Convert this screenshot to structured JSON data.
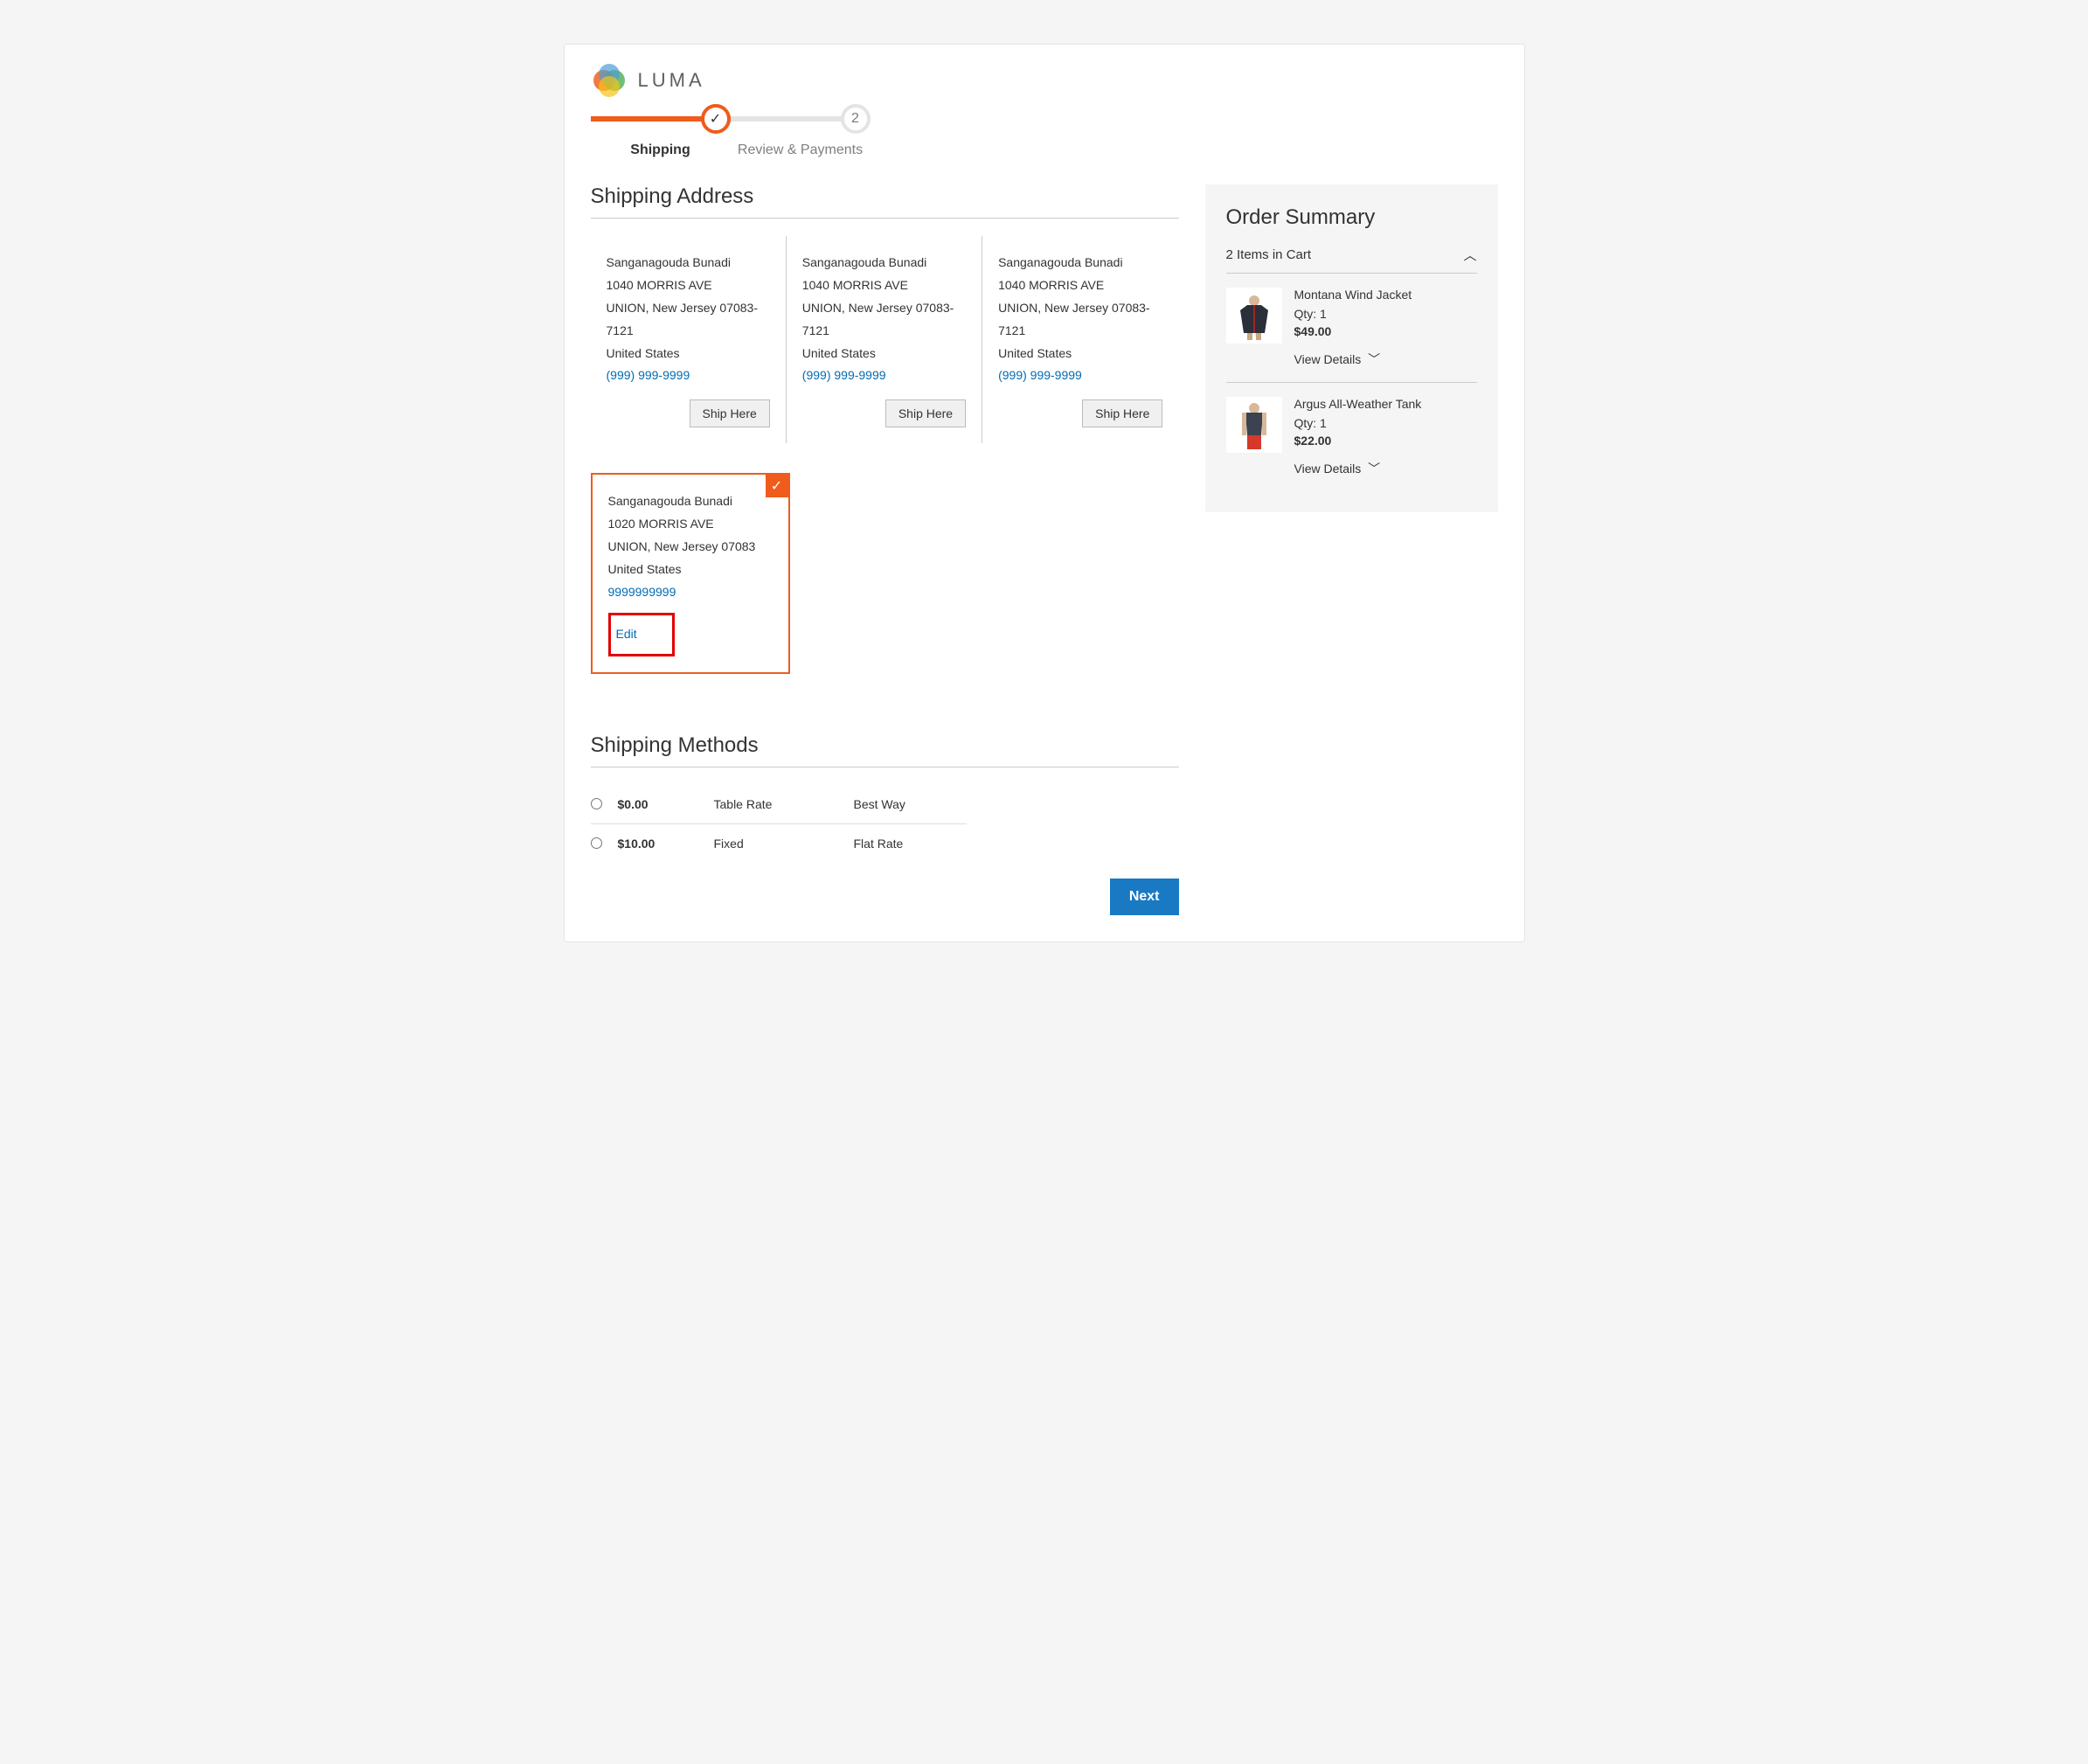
{
  "brand": {
    "name": "LUMA"
  },
  "progress": {
    "step1": {
      "label": "Shipping",
      "icon": "✓"
    },
    "step2": {
      "label": "Review & Payments",
      "number": "2"
    }
  },
  "sections": {
    "shipping_address_title": "Shipping Address",
    "shipping_methods_title": "Shipping Methods"
  },
  "addresses": [
    {
      "name": "Sanganagouda Bunadi",
      "street": "1040 MORRIS AVE",
      "city_state_zip": "UNION, New Jersey 07083-7121",
      "country": "United States",
      "phone": "(999) 999-9999",
      "ship_here": "Ship Here"
    },
    {
      "name": "Sanganagouda Bunadi",
      "street": "1040 MORRIS AVE",
      "city_state_zip": "UNION, New Jersey 07083-7121",
      "country": "United States",
      "phone": "(999) 999-9999",
      "ship_here": "Ship Here"
    },
    {
      "name": "Sanganagouda Bunadi",
      "street": "1040 MORRIS AVE",
      "city_state_zip": "UNION, New Jersey 07083-7121",
      "country": "United States",
      "phone": "(999) 999-9999",
      "ship_here": "Ship Here"
    }
  ],
  "selected_address": {
    "name": "Sanganagouda Bunadi",
    "street": "1020 MORRIS AVE",
    "city_state_zip": "UNION, New Jersey 07083",
    "country": "United States",
    "phone": "9999999999",
    "edit_label": "Edit"
  },
  "shipping_methods": [
    {
      "price": "$0.00",
      "carrier": "Table Rate",
      "title": "Best Way"
    },
    {
      "price": "$10.00",
      "carrier": "Fixed",
      "title": "Flat Rate"
    }
  ],
  "next_button": "Next",
  "order_summary": {
    "title": "Order Summary",
    "cart_count_label": "2 Items in Cart",
    "items": [
      {
        "name": "Montana Wind Jacket",
        "qty_label": "Qty: 1",
        "price": "$49.00",
        "view_details": "View Details"
      },
      {
        "name": "Argus All-Weather Tank",
        "qty_label": "Qty: 1",
        "price": "$22.00",
        "view_details": "View Details"
      }
    ]
  }
}
